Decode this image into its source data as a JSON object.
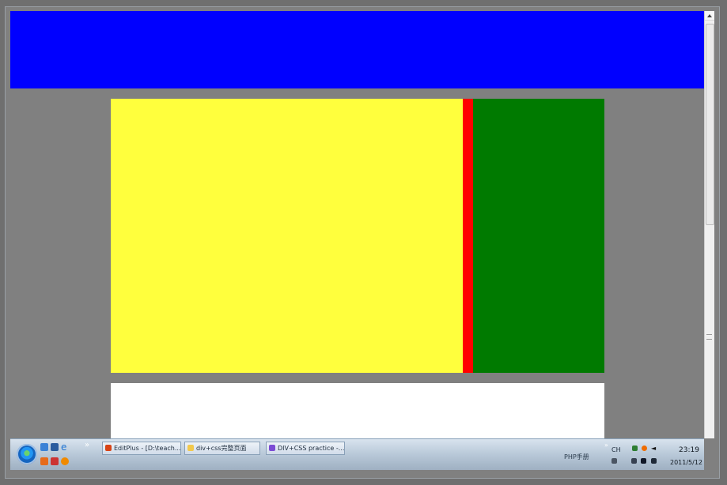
{
  "colors": {
    "header_blue": "#0000ff",
    "page_gray": "#808080",
    "main_yellow": "#ffff3d",
    "divider_red": "#ff0000",
    "side_green": "#007a00",
    "footer_white": "#ffffff",
    "taskbar_top": "#d8e3ee",
    "taskbar_bottom": "#9fb0c2"
  },
  "taskbar": {
    "buttons": [
      {
        "label": "EditPlus - [D:\\teach..."
      },
      {
        "label": "div+css完整页面"
      },
      {
        "label": "DIV+CSS practice -..."
      }
    ],
    "quick_launch_icons": [
      "show-desktop-icon",
      "window-switcher-icon",
      "ie-icon",
      "qq-icon",
      "app-icon",
      "firefox-icon"
    ],
    "tray": {
      "php_label": "PHP手册",
      "ime_label": "CH",
      "time": "23:19",
      "date": "2011/5/12",
      "icons": [
        "network-icon",
        "firefox-tray-icon",
        "volume-icon",
        "keyboard-icon",
        "flag-icon",
        "usb-icon",
        "display-icon"
      ]
    }
  }
}
